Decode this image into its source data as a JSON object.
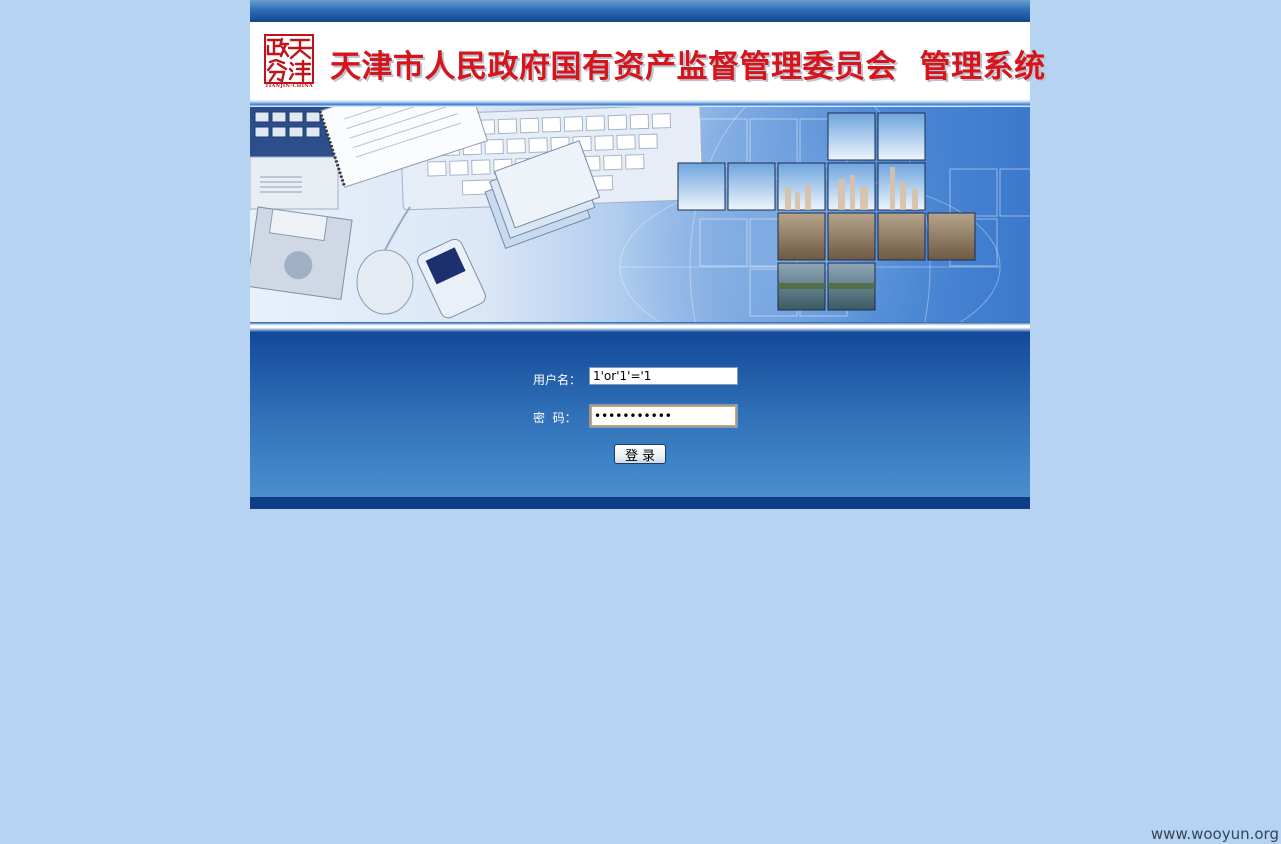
{
  "header": {
    "seal_text": "天津 政务",
    "seal_caption": "TIANJIN-CHINA",
    "title": "天津市人民政府国有资产监督管理委员会  管理系统"
  },
  "login": {
    "username_label": "用户名：",
    "password_label": "密  码：",
    "username_value": "1'or'1'='1",
    "password_value": "1'or'1'='1'",
    "submit_label": "登录"
  },
  "watermark": "www.wooyun.org",
  "colors": {
    "page_background": "#b6d3f1",
    "title_red": "#d7141a",
    "login_panel_blue": "#2d6db4"
  }
}
